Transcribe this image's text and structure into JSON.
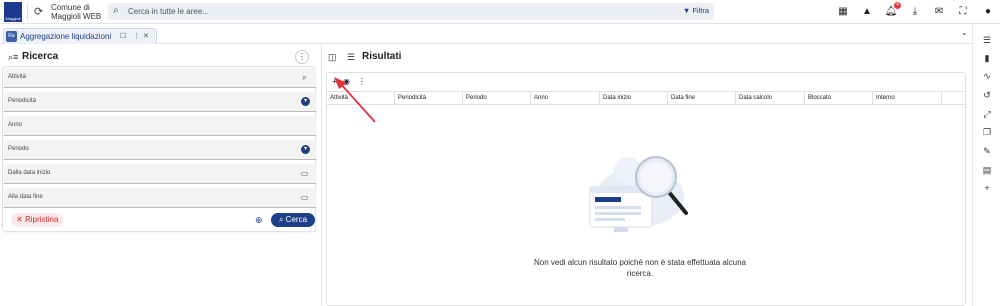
{
  "topbar": {
    "logo_text": "Maggioli",
    "org_name": "Comune di Maggioli WEB",
    "search_placeholder": "Cerca in tutte le aree...",
    "filter_label": "Filtra",
    "notification_count": "4",
    "icons": [
      "dashboard-icon",
      "warning-icon",
      "bell-icon",
      "download-icon",
      "mail-icon",
      "fullscreen-icon",
      "user-icon"
    ]
  },
  "tabs": [
    {
      "badge": "Ra",
      "label": "Aggregazione liquidazioni"
    }
  ],
  "left_panel": {
    "title": "Ricerca",
    "fields": [
      {
        "label": "Attività",
        "icon": "search-icon"
      },
      {
        "label": "Periodicità",
        "icon": "dropdown-icon"
      },
      {
        "label": "Anno",
        "icon": ""
      },
      {
        "label": "Periodo",
        "icon": "dropdown-icon"
      },
      {
        "label": "Dalla data inizio",
        "icon": "calendar-icon"
      },
      {
        "label": "Alla data fine",
        "icon": "calendar-icon"
      }
    ],
    "reset_label": "Ripristina",
    "search_label": "Cerca"
  },
  "right_panel": {
    "title": "Risultati",
    "columns": [
      "Attività",
      "Periodicità",
      "Periodo",
      "Anno",
      "Data inizio",
      "Data fine",
      "Data calcolo",
      "Bloccato",
      "Interno"
    ],
    "empty_text": "Non vedi alcun risultato poiché non è stata effettuata alcuna ricerca."
  },
  "rail_icons": [
    "list-settings-icon",
    "book-icon",
    "trend-icon",
    "history-icon",
    "link-icon",
    "copy-icon",
    "edit-doc-icon",
    "doc-icon",
    "plus-icon"
  ],
  "colors": {
    "primary": "#1d3f8a",
    "danger": "#d32f2f",
    "arrow": "#e0353f"
  }
}
